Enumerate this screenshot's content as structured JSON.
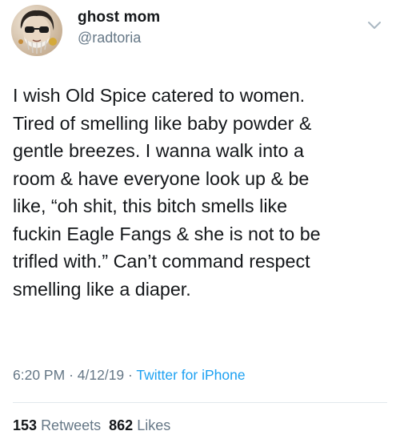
{
  "user": {
    "display_name": "ghost mom",
    "handle": "@radtoria"
  },
  "tweet": {
    "text": "I wish Old Spice catered to women.\nTired of smelling like baby powder &\ngentle breezes. I wanna walk into a\nroom & have everyone look up & be\nlike, “oh shit, this bitch smells like\nfuckin Eagle Fangs & she is not to be\ntrifled with.” Can’t command respect\nsmelling like a diaper.",
    "time": "6:20 PM",
    "separator": "·",
    "date": "4/12/19",
    "source": "Twitter for iPhone"
  },
  "stats": {
    "retweets_count": "153",
    "retweets_label": "Retweets",
    "likes_count": "862",
    "likes_label": "Likes"
  },
  "icons": {
    "avatar": "avatar-image",
    "menu": "chevron-down-icon"
  },
  "colors": {
    "text": "#14171a",
    "secondary": "#657786",
    "link": "#1da1f2",
    "divider": "#e1e8ed"
  }
}
